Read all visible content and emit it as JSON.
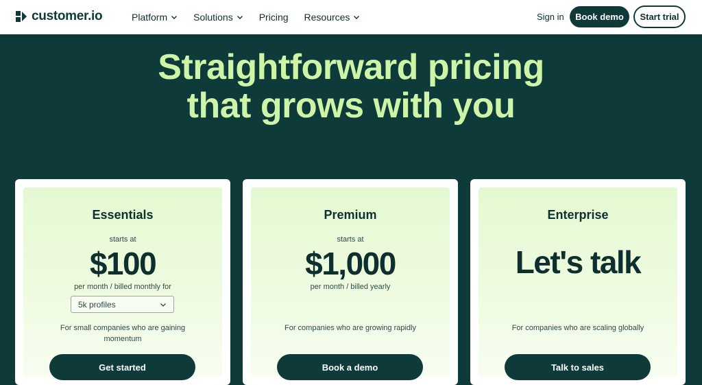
{
  "brand": {
    "name": "customer.io"
  },
  "nav": {
    "items": [
      {
        "label": "Platform",
        "has_dropdown": true
      },
      {
        "label": "Solutions",
        "has_dropdown": true
      },
      {
        "label": "Pricing",
        "has_dropdown": false
      },
      {
        "label": "Resources",
        "has_dropdown": true
      }
    ],
    "sign_in": "Sign in",
    "book_demo": "Book demo",
    "start_trial": "Start trial"
  },
  "hero": {
    "line1": "Straightforward pricing",
    "line2": "that grows with you"
  },
  "plans": [
    {
      "title": "Essentials",
      "starts_at": "starts at",
      "price": "$100",
      "billing": "per month / billed monthly for",
      "profiles_select": "5k profiles",
      "description": "For small companies who are gaining momentum",
      "cta": "Get started"
    },
    {
      "title": "Premium",
      "starts_at": "starts at",
      "price": "$1,000",
      "billing": "per month / billed yearly",
      "description": "For companies who are growing rapidly",
      "cta": "Book a demo"
    },
    {
      "title": "Enterprise",
      "price": "Let's talk",
      "description": "For companies who are scaling globally",
      "cta": "Talk to sales"
    }
  ],
  "colors": {
    "brand_dark": "#0f3a3a",
    "hero_text": "#cdf5a8",
    "card_tint": "#e4f9d2"
  }
}
